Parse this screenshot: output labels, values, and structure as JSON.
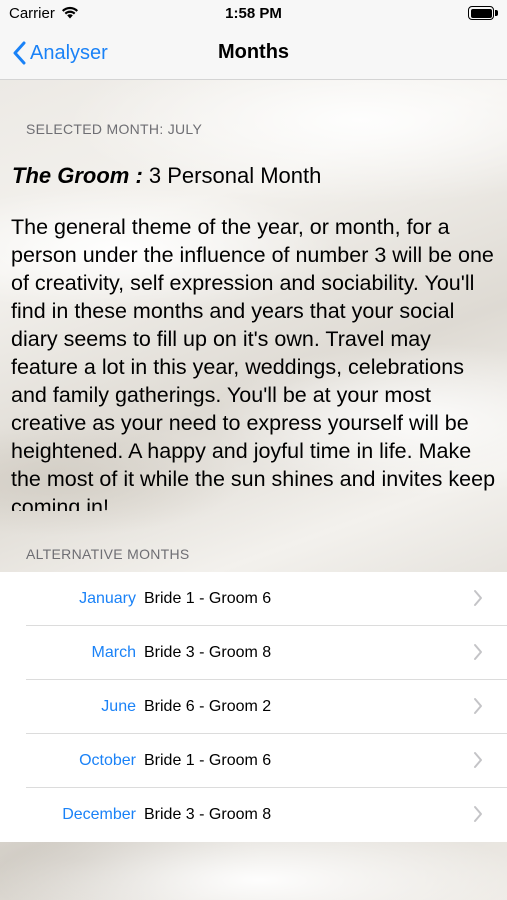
{
  "status_bar": {
    "carrier": "Carrier",
    "time": "1:58 PM"
  },
  "nav": {
    "back_label": "Analyser",
    "title": "Months"
  },
  "selected": {
    "header": "SELECTED MONTH: JULY",
    "person_label": "The Groom :",
    "personal_month": "3 Personal Month",
    "description": "The general theme of the year, or month, for a person under the influence of number 3 will be one of creativity, self expression and sociability. You'll find in these months and years that your social diary seems to fill up on it's own. Travel may feature a lot in this year, weddings, celebrations and family gatherings. You'll be at your most creative as your need to express yourself will be heightened. A happy and joyful time in life. Make the most of it while the sun shines and invites keep coming in!"
  },
  "alternatives": {
    "header": "ALTERNATIVE MONTHS",
    "rows": [
      {
        "month": "January",
        "pair": "Bride 1 - Groom 6"
      },
      {
        "month": "March",
        "pair": "Bride 3 - Groom 8"
      },
      {
        "month": "June",
        "pair": "Bride 6 - Groom 2"
      },
      {
        "month": "October",
        "pair": "Bride 1 - Groom 6"
      },
      {
        "month": "December",
        "pair": "Bride 3 - Groom 8"
      }
    ]
  },
  "colors": {
    "accent": "#1a82f7",
    "section_header": "#6e6e73"
  }
}
